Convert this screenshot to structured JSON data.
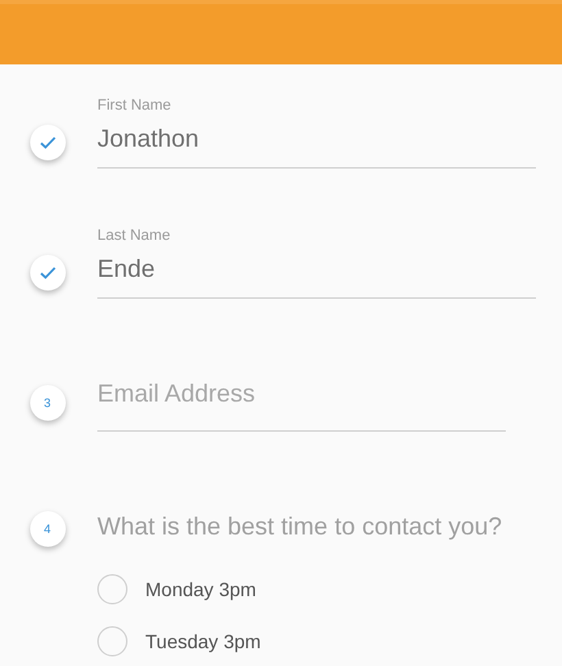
{
  "steps": [
    {
      "kind": "field",
      "done": true,
      "label": "First Name",
      "value": "Jonathon"
    },
    {
      "kind": "field",
      "done": true,
      "label": "Last Name",
      "value": "Ende"
    },
    {
      "kind": "field",
      "done": false,
      "number": "3",
      "placeholder": "Email Address"
    },
    {
      "kind": "choice",
      "done": false,
      "number": "4",
      "question": "What is the best time to contact you?",
      "options": [
        {
          "label": "Monday 3pm",
          "selected": false
        },
        {
          "label": "Tuesday 3pm",
          "selected": false
        }
      ]
    }
  ]
}
